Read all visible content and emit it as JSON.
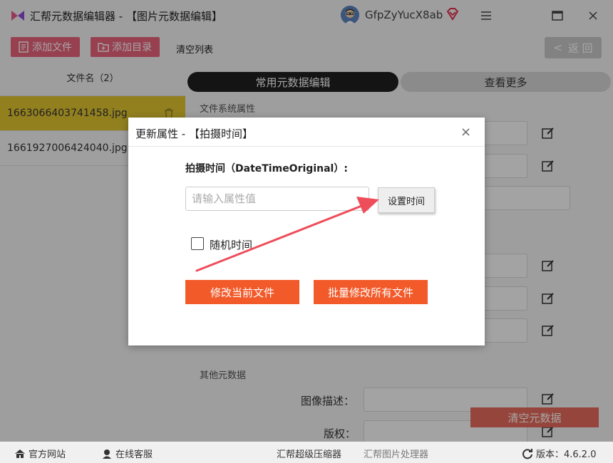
{
  "app": {
    "title": "汇帮元数据编辑器 - 【图片元数据编辑】",
    "username": "GfpZyYucX8ab"
  },
  "toolbar": {
    "add_file": "添加文件",
    "add_dir": "添加目录",
    "clear_list": "清空列表",
    "back": "返 回"
  },
  "sidebar": {
    "header": "文件名（2）",
    "files": [
      {
        "name": "1663066403741458.jpg"
      },
      {
        "name": "1661927006424040.jpg"
      }
    ]
  },
  "main": {
    "tabs": [
      {
        "label": "常用元数据编辑"
      },
      {
        "label": "查看更多"
      }
    ],
    "section_fs": "文件系统属性",
    "section_other": "其他元数据",
    "field_desc": "图像描述：",
    "field_copyright": "版权：",
    "clear_btn": "清空元数据"
  },
  "dialog": {
    "title": "更新属性 - 【拍摄时间】",
    "close": "×",
    "field_label": "拍摄时间（DateTimeOriginal）:",
    "input_placeholder": "请输入属性值",
    "set_time": "设置时间",
    "random_time": "随机时间",
    "modify_current": "修改当前文件",
    "modify_all": "批量修改所有文件"
  },
  "status": {
    "official_site": "官方网站",
    "online_service": "在线客服",
    "compressor": "汇帮超级压缩器",
    "image_processor": "汇帮图片处理器",
    "version": "版本：4.6.2.0"
  },
  "colors": {
    "pink": "#e8637b",
    "orange": "#f25a2a",
    "selected": "#e1c531",
    "arrow": "#ee4d5a"
  }
}
